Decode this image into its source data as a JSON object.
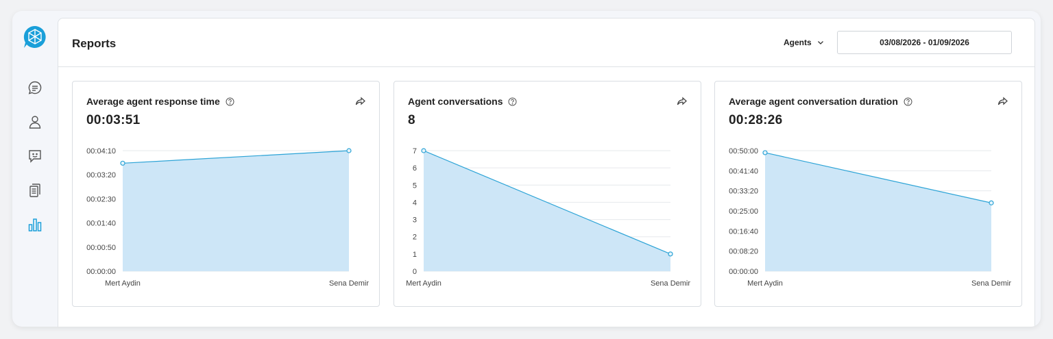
{
  "sidebar": {
    "items": [
      {
        "icon": "chat-bubble-icon",
        "active": false
      },
      {
        "icon": "user-icon",
        "active": false
      },
      {
        "icon": "feedback-icon",
        "active": false
      },
      {
        "icon": "documents-icon",
        "active": false
      },
      {
        "icon": "bar-chart-icon",
        "active": true
      }
    ]
  },
  "colors": {
    "accent": "#1a9fd9",
    "fill": "#cde6f7",
    "line": "#2ba3d6",
    "grid": "#e6e8eb"
  },
  "header": {
    "title": "Reports",
    "agents_label": "Agents",
    "date_range": "03/08/2026 - 01/09/2026"
  },
  "cards": [
    {
      "title": "Average agent response time",
      "value": "00:03:51",
      "chart_data": {
        "type": "area",
        "categories": [
          "Mert Aydin",
          "Sena Demir"
        ],
        "values": [
          224,
          252
        ],
        "ylim": [
          0,
          250
        ],
        "ytick_values": [
          0,
          50,
          100,
          150,
          200,
          250
        ],
        "ytick_labels": [
          "00:00:00",
          "00:00:50",
          "00:01:40",
          "00:02:30",
          "00:03:20",
          "00:04:10"
        ],
        "xlabel": "",
        "ylabel": "",
        "grid": true
      }
    },
    {
      "title": "Agent conversations",
      "value": "8",
      "chart_data": {
        "type": "area",
        "categories": [
          "Mert Aydin",
          "Sena Demir"
        ],
        "values": [
          7,
          1
        ],
        "ylim": [
          0,
          7
        ],
        "ytick_values": [
          0,
          1,
          2,
          3,
          4,
          5,
          6,
          7
        ],
        "ytick_labels": [
          "0",
          "1",
          "2",
          "3",
          "4",
          "5",
          "6",
          "7"
        ],
        "xlabel": "",
        "ylabel": "",
        "grid": true
      }
    },
    {
      "title": "Average agent conversation duration",
      "value": "00:28:26",
      "chart_data": {
        "type": "area",
        "categories": [
          "Mert Aydin",
          "Sena Demir"
        ],
        "values": [
          2950,
          1700
        ],
        "ylim": [
          0,
          3000
        ],
        "ytick_values": [
          0,
          500,
          1000,
          1500,
          2000,
          2500,
          3000
        ],
        "ytick_labels": [
          "00:00:00",
          "00:08:20",
          "00:16:40",
          "00:25:00",
          "00:33:20",
          "00:41:40",
          "00:50:00"
        ],
        "xlabel": "",
        "ylabel": "",
        "grid": true
      }
    }
  ]
}
